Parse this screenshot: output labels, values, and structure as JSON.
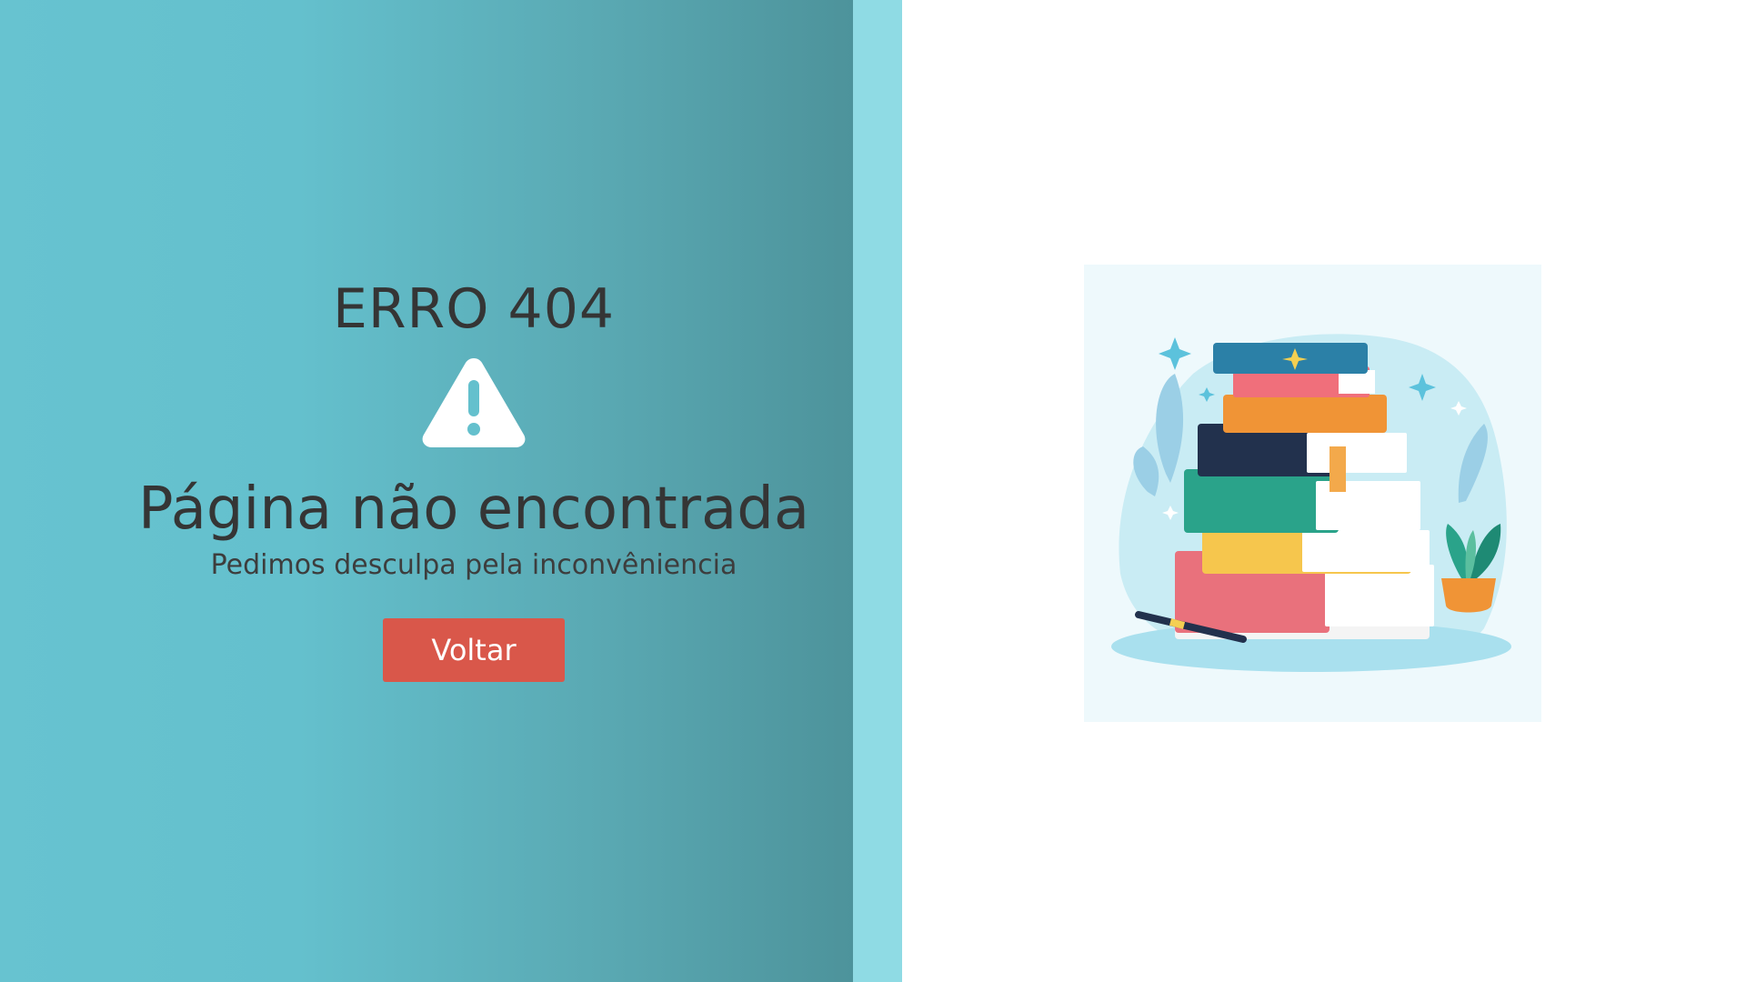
{
  "error": {
    "code_label": "ERRO 404",
    "title": "Página não encontrada",
    "message": "Pedimos desculpa pela inconvêniencia",
    "back_button_label": "Voltar"
  },
  "icons": {
    "warning": "warning-triangle-icon"
  },
  "colors": {
    "panel_gradient_start": "#67c3d0",
    "panel_gradient_end": "#4d939b",
    "accent_strip": "#8fdbe4",
    "button": "#d9574a",
    "text_dark": "#353535"
  }
}
